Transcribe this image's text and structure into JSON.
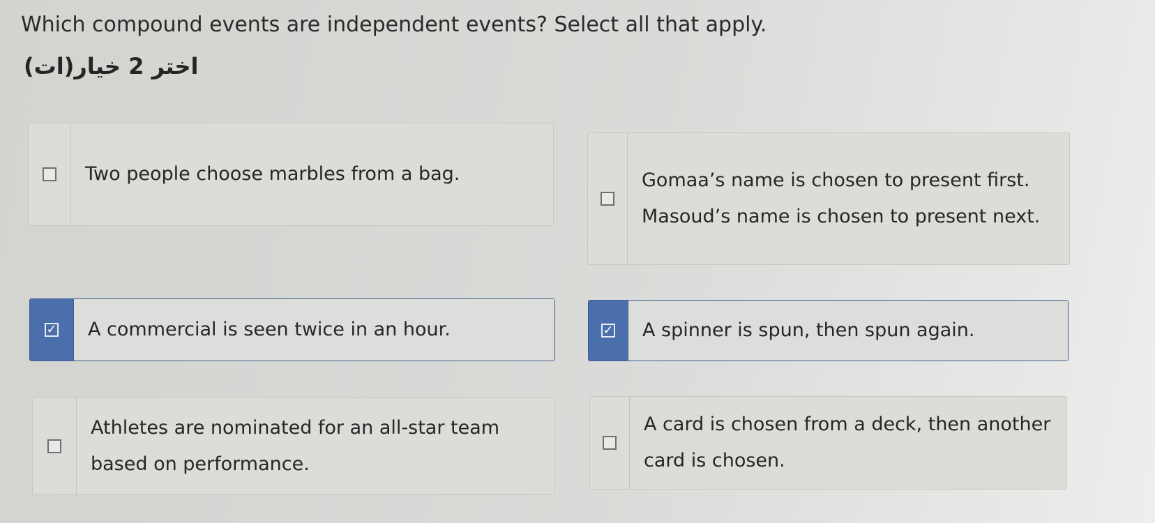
{
  "question": "Which compound events are independent events? Select all that apply.",
  "subtitle": "اختر 2 خيار(ات)",
  "options": [
    {
      "label": "Two people choose marbles from a bag.",
      "checked": false
    },
    {
      "label": "Gomaa’s name is chosen to present first. Masoud’s name is chosen to present next.",
      "checked": false
    },
    {
      "label": "A commercial is seen twice in an hour.",
      "checked": true
    },
    {
      "label": "A spinner is spun, then spun again.",
      "checked": true
    },
    {
      "label": "Athletes are nominated for an all-star team based on performance.",
      "checked": false
    },
    {
      "label": "A card is chosen from a deck, then another card is chosen.",
      "checked": false
    }
  ],
  "check_mark": "✓",
  "colors": {
    "selected_accent": "#4b6fac",
    "background": "#d6d7d3"
  }
}
